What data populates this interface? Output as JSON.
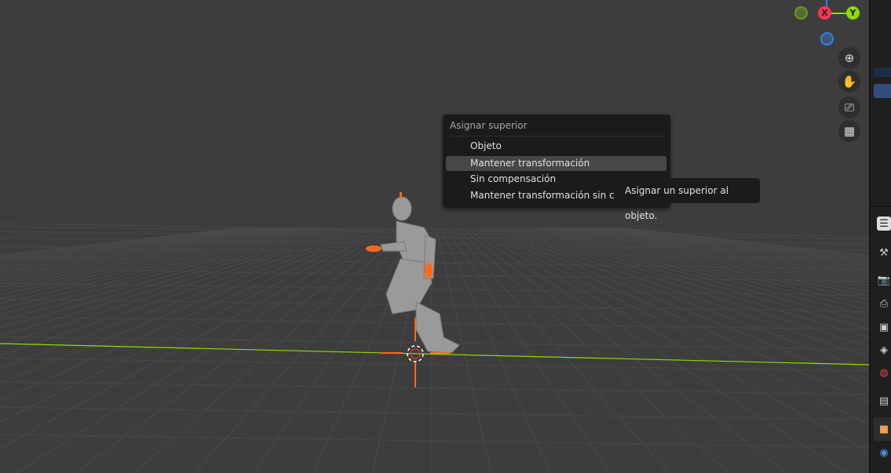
{
  "gizmo": {
    "x_label": "X",
    "y_label": "Y"
  },
  "nav_buttons": [
    {
      "name": "zoom-icon",
      "glyph": "🔍"
    },
    {
      "name": "pan-hand-icon",
      "glyph": "✋"
    },
    {
      "name": "camera-icon",
      "glyph": "🎥"
    },
    {
      "name": "grid-perspective-icon",
      "glyph": "▦"
    }
  ],
  "menu": {
    "title": "Asignar superior",
    "items": [
      {
        "label": "Objeto"
      },
      {
        "label": "Mantener transformación",
        "highlighted": true
      },
      {
        "label": "Sin compensación"
      },
      {
        "label": "Mantener transformación sin compensación"
      }
    ]
  },
  "tooltip": {
    "text": "Asignar un superior al objeto."
  },
  "properties_tabs": [
    "tool",
    "render",
    "output",
    "view-layer",
    "scene",
    "world",
    "collection",
    "object",
    "modifiers"
  ],
  "colors": {
    "x_axis": "#ff3352",
    "y_axis": "#8bdc00",
    "z_axis": "#2f83e3",
    "selection": "#ff7a1f",
    "highlight": "#474747"
  }
}
